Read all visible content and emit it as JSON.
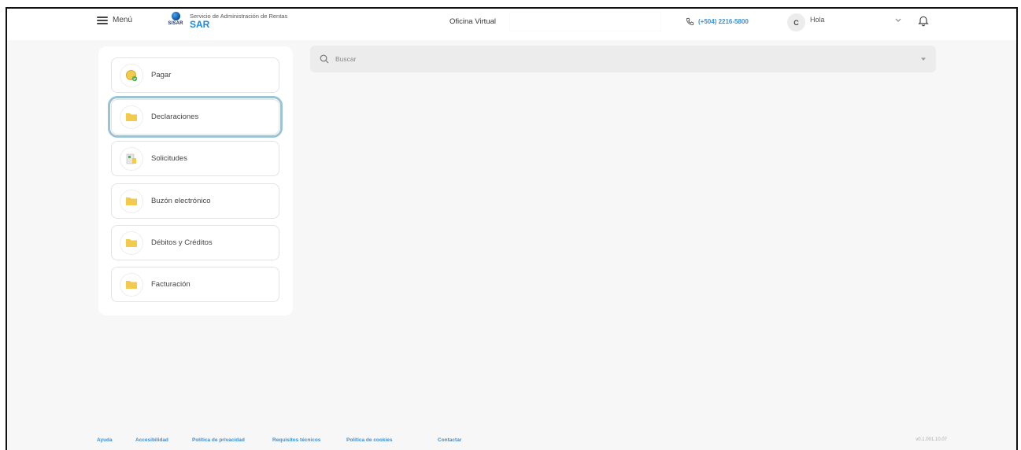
{
  "header": {
    "menu_label": "Menú",
    "logo_small": "SISAR",
    "logo_subtitle": "Servicio de Administración de Rentas",
    "logo_main": "SAR",
    "office_title": "Oficina Virtual",
    "phone": "(+504) 2216-5800",
    "avatar_initial": "C",
    "greeting": "Hola"
  },
  "side_menu": {
    "items": [
      {
        "label": "Pagar",
        "icon": "coin-icon"
      },
      {
        "label": "Declaraciones",
        "icon": "folder-icon"
      },
      {
        "label": "Solicitudes",
        "icon": "document-icon"
      },
      {
        "label": "Buzón electrónico",
        "icon": "folder-icon"
      },
      {
        "label": "Débitos y Créditos",
        "icon": "folder-icon"
      },
      {
        "label": "Facturación",
        "icon": "folder-icon"
      }
    ],
    "selected": "Declaraciones"
  },
  "search": {
    "placeholder": "Buscar"
  },
  "footer": {
    "links": [
      "Ayuda",
      "Accesibilidad",
      "Política de privacidad",
      "Requisitos técnicos",
      "Política de cookies",
      "Contactar"
    ],
    "version": "v0.1.001.10.07"
  },
  "colors": {
    "accent": "#3d8fd1",
    "logo_blue": "#1e88d6",
    "folder_yellow": "#f2cb4e",
    "selected_outline": "#9cc3d3",
    "background": "#f7f7f7"
  }
}
